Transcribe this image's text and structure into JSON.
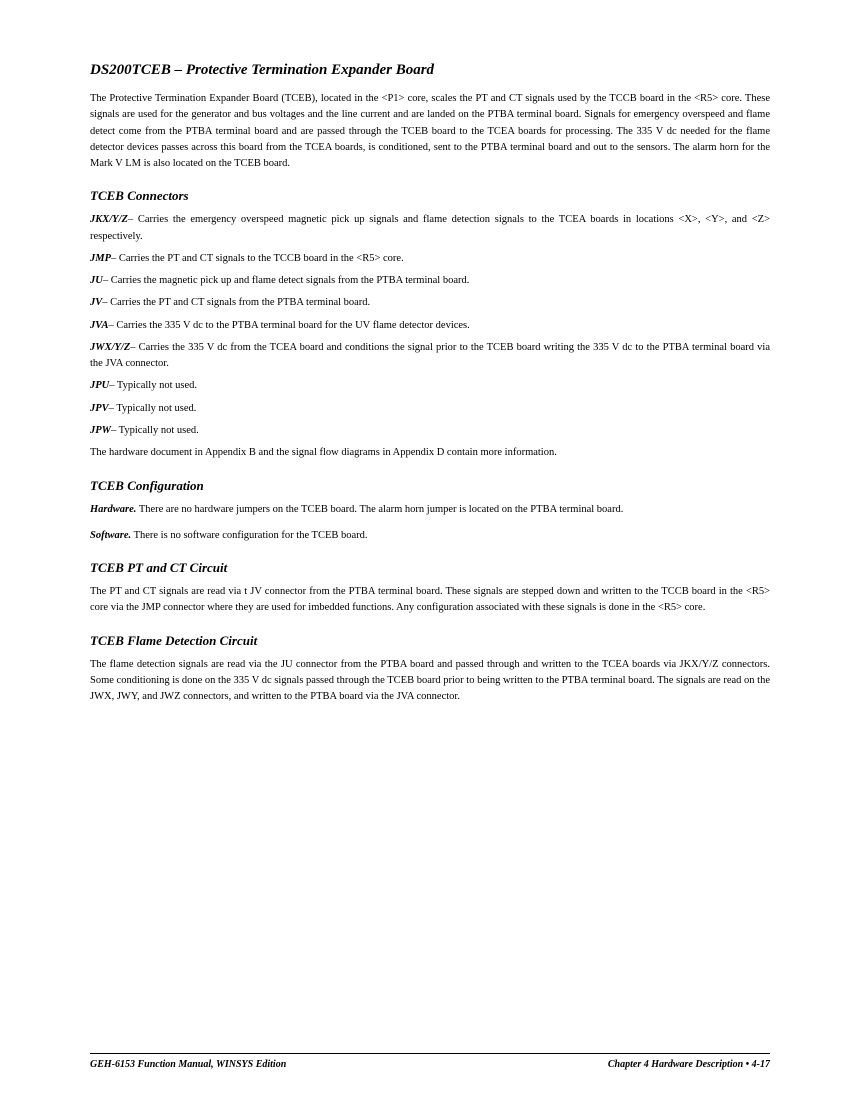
{
  "page": {
    "main_title": "DS200TCEB – Protective Termination Expander Board",
    "intro_paragraph": "The Protective Termination Expander Board (TCEB), located in the <P1> core, scales the PT and CT signals used by the TCCB board in the <R5> core. These signals are used for the generator and bus voltages and the line current and are landed on the PTBA terminal board. Signals for emergency overspeed and flame detect come from the PTBA terminal board and are passed through the TCEB board to the TCEA boards for processing. The 335 V dc needed for the flame detector devices passes across this board from the TCEA boards, is conditioned, sent to the PTBA terminal board and out to the sensors. The alarm horn for the Mark V LM is also located on the TCEB board.",
    "connectors_title": "TCEB Connectors",
    "connectors": [
      {
        "label": "JKX/Y/Z",
        "text": "– Carries the emergency overspeed magnetic pick up signals and flame detection signals to the TCEA boards in locations <X>, <Y>, and <Z> respectively."
      },
      {
        "label": "JMP",
        "text": "– Carries the PT and CT signals to the TCCB board in the <R5> core."
      },
      {
        "label": "JU",
        "text": "– Carries the magnetic pick up and flame detect signals from the PTBA terminal board."
      },
      {
        "label": "JV",
        "text": "– Carries the PT and CT signals from the PTBA terminal board."
      },
      {
        "label": "JVA",
        "text": "– Carries the 335 V dc to the PTBA terminal board for the UV flame detector devices."
      },
      {
        "label": "JWX/Y/Z",
        "text": "– Carries the 335 V dc from the TCEA board and conditions the signal prior to the TCEB board writing the 335 V dc to the PTBA terminal board via the JVA connector."
      },
      {
        "label": "JPU",
        "text": "– Typically not used."
      },
      {
        "label": "JPV",
        "text": "– Typically not used."
      },
      {
        "label": "JPW",
        "text": "– Typically not used."
      }
    ],
    "connectors_appendix": "The hardware document in Appendix B and the signal flow diagrams in Appendix D contain more information.",
    "configuration_title": "TCEB Configuration",
    "configuration_hardware": "Hardware. There are no hardware jumpers on the TCEB board. The alarm horn jumper is located on the PTBA terminal board.",
    "configuration_software": "Software. There is no software configuration for the TCEB board.",
    "ptct_title": "TCEB PT and CT Circuit",
    "ptct_paragraph": "The PT and CT signals are read via t JV connector from the PTBA terminal board. These signals are stepped down and written to the TCCB board in the <R5> core via the JMP connector where they are used for imbedded functions. Any configuration associated with these signals is done in the <R5> core.",
    "flame_title": "TCEB Flame Detection Circuit",
    "flame_paragraph": "The flame detection signals are read via the JU connector from the PTBA board and passed through and written to the TCEA boards via JKX/Y/Z connectors. Some conditioning is done on the 335 V dc signals passed through the TCEB board prior to being written to the PTBA terminal board. The signals are read on the JWX, JWY, and JWZ connectors, and written to the PTBA board via the JVA connector.",
    "footer": {
      "left": "GEH-6153   Function Manual, WINSYS Edition",
      "right": "Chapter 4  Hardware Description • 4-17"
    }
  }
}
